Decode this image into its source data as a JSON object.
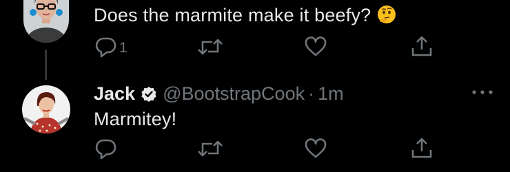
{
  "tweet1": {
    "text": "Does the marmite make it beefy?",
    "emoji": "thinking-face",
    "reply_count": "1"
  },
  "tweet2": {
    "name": "Jack",
    "handle": "@BootstrapCook",
    "separator": "·",
    "time": "1m",
    "text": "Marmitey!"
  },
  "colors": {
    "background": "#000000",
    "text": "#e7e9ea",
    "secondary": "#71767b",
    "verified": "#e7e9ea"
  }
}
